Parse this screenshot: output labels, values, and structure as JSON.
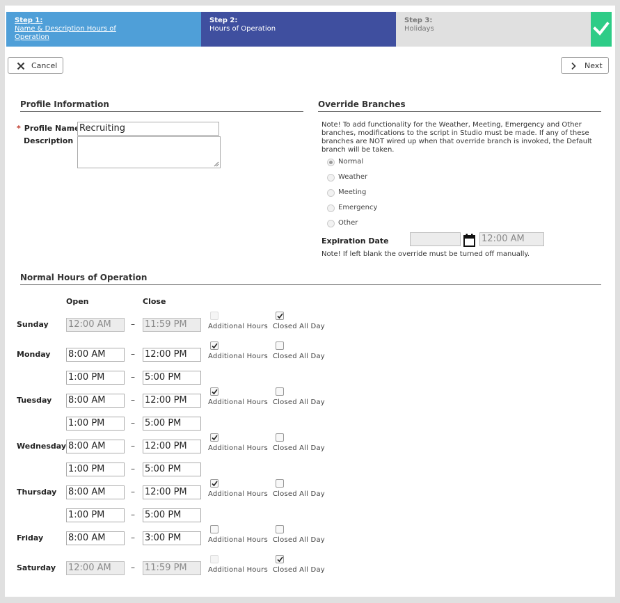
{
  "steps": {
    "step1": {
      "title": "Step 1:",
      "desc": "Name & Description Hours of Operation"
    },
    "step2": {
      "title": "Step 2:",
      "desc": "Hours of Operation"
    },
    "step3": {
      "title": "Step 3:",
      "desc": "Holidays"
    },
    "complete_icon": "checkmark-icon"
  },
  "toolbar": {
    "cancel_label": "Cancel",
    "next_label": "Next",
    "cancel_icon": "close-icon",
    "next_icon": "chevron-right-icon"
  },
  "profile": {
    "section_title": "Profile Information",
    "name_label": "Profile Name",
    "required_marker": "*",
    "name_value": "Recruiting",
    "description_label": "Description",
    "description_value": ""
  },
  "override": {
    "section_title": "Override Branches",
    "note": "Note! To add functionality for the Weather, Meeting, Emergency and Other branches, modifications to the script in Studio must be made. If any of these branches are NOT wired up when that override branch is invoked, the Default branch will be taken.",
    "options": [
      {
        "label": "Normal",
        "selected": true
      },
      {
        "label": "Weather",
        "selected": false
      },
      {
        "label": "Meeting",
        "selected": false
      },
      {
        "label": "Emergency",
        "selected": false
      },
      {
        "label": "Other",
        "selected": false
      }
    ],
    "expiration_label": "Expiration Date",
    "expiration_date": "",
    "expiration_time": "12:00 AM",
    "calendar_icon": "calendar-icon",
    "expiration_note": "Note! If left blank the override must be turned off manually."
  },
  "hours": {
    "section_title": "Normal Hours of Operation",
    "open_header": "Open",
    "close_header": "Close",
    "separator": "–",
    "additional_label": "Additional Hours",
    "closed_label": "Closed All Day",
    "days": [
      {
        "name": "Sunday",
        "open": "12:00 AM",
        "close": "11:59 PM",
        "extra_open": null,
        "extra_close": null,
        "additional": false,
        "closed": true
      },
      {
        "name": "Monday",
        "open": "8:00 AM",
        "close": "12:00 PM",
        "extra_open": "1:00 PM",
        "extra_close": "5:00 PM",
        "additional": true,
        "closed": false
      },
      {
        "name": "Tuesday",
        "open": "8:00 AM",
        "close": "12:00 PM",
        "extra_open": "1:00 PM",
        "extra_close": "5:00 PM",
        "additional": true,
        "closed": false
      },
      {
        "name": "Wednesday",
        "open": "8:00 AM",
        "close": "12:00 PM",
        "extra_open": "1:00 PM",
        "extra_close": "5:00 PM",
        "additional": true,
        "closed": false
      },
      {
        "name": "Thursday",
        "open": "8:00 AM",
        "close": "12:00 PM",
        "extra_open": "1:00 PM",
        "extra_close": "5:00 PM",
        "additional": true,
        "closed": false
      },
      {
        "name": "Friday",
        "open": "8:00 AM",
        "close": "3:00 PM",
        "extra_open": null,
        "extra_close": null,
        "additional": false,
        "closed": false
      },
      {
        "name": "Saturday",
        "open": "12:00 AM",
        "close": "11:59 PM",
        "extra_open": null,
        "extra_close": null,
        "additional": false,
        "closed": true
      }
    ]
  }
}
